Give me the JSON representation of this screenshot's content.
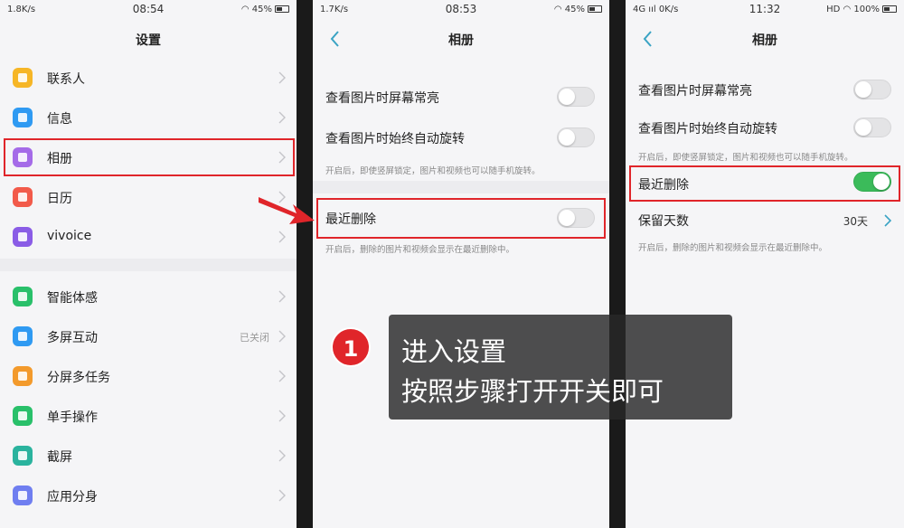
{
  "screen1": {
    "status": {
      "speed": "1.8K/s",
      "time": "08:54",
      "battery": "45%"
    },
    "title": "设置",
    "items": [
      {
        "label": "联系人",
        "icon": "contacts-icon",
        "color": "#f6b626"
      },
      {
        "label": "信息",
        "icon": "messages-icon",
        "color": "#2f9af2"
      },
      {
        "label": "相册",
        "icon": "gallery-icon",
        "color": "#a56be8"
      },
      {
        "label": "日历",
        "icon": "calendar-icon",
        "color": "#f25a4a"
      },
      {
        "label": "vivoice",
        "icon": "microphone-icon",
        "color": "#8a5ce6"
      },
      {
        "label": "智能体感",
        "icon": "motion-icon",
        "color": "#29c06a"
      },
      {
        "label": "多屏互动",
        "icon": "multiscreen-icon",
        "color": "#2f9af2",
        "value": "已关闭"
      },
      {
        "label": "分屏多任务",
        "icon": "split-screen-icon",
        "color": "#f39a2c"
      },
      {
        "label": "单手操作",
        "icon": "one-hand-icon",
        "color": "#29c06a"
      },
      {
        "label": "截屏",
        "icon": "screenshot-icon",
        "color": "#2ab39e"
      },
      {
        "label": "应用分身",
        "icon": "app-clone-icon",
        "color": "#6f7ef0"
      }
    ]
  },
  "screen2": {
    "status": {
      "speed": "1.7K/s",
      "time": "08:53",
      "battery": "45%"
    },
    "title": "相册",
    "rows": [
      {
        "label": "查看图片时屏幕常亮",
        "on": false
      },
      {
        "label": "查看图片时始终自动旋转",
        "on": false
      }
    ],
    "rotate_desc": "开启后，即使竖屏锁定，图片和视频也可以随手机旋转。",
    "recent_delete": {
      "label": "最近删除",
      "on": false
    },
    "recent_desc": "开启后，删除的图片和视频会显示在最近删除中。"
  },
  "screen3": {
    "status": {
      "speed": "0K/s",
      "time": "11:32",
      "network": "HD",
      "battery": "100%"
    },
    "title": "相册",
    "rows": [
      {
        "label": "查看图片时屏幕常亮",
        "on": false
      },
      {
        "label": "查看图片时始终自动旋转",
        "on": false
      }
    ],
    "rotate_desc": "开启后，即使竖屏锁定，图片和视频也可以随手机旋转。",
    "recent_delete": {
      "label": "最近删除",
      "on": true
    },
    "retention": {
      "label": "保留天数",
      "value": "30天"
    },
    "recent_desc": "开启后，删除的图片和视频会显示在最近删除中。"
  },
  "callout": {
    "step": "1",
    "line1": "进入设置",
    "line2": "按照步骤打开开关即可"
  },
  "colors": {
    "highlight": "#e0252a",
    "toggle_on": "#3bbb5a",
    "back_arrow": "#3aa3c4"
  }
}
